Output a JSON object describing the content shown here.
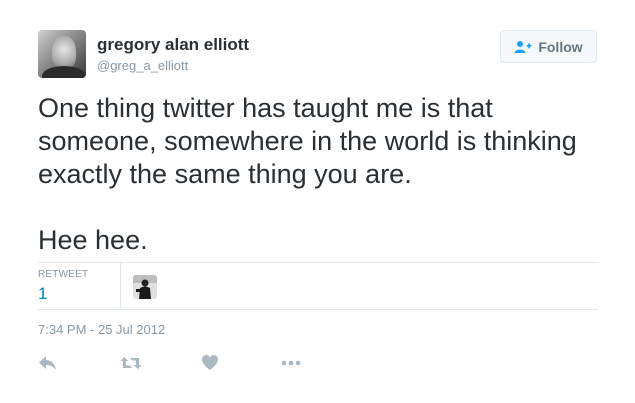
{
  "tweet": {
    "author": {
      "fullname": "gregory alan elliott",
      "username": "@greg_a_elliott"
    },
    "follow_label": "Follow",
    "text": "One thing twitter has taught me is that\nsomeone, somewhere in the world is thinking\nexactly the same thing you are.\n\nHee hee.",
    "stats": {
      "retweet_label": "RETWEET",
      "retweet_count": "1"
    },
    "timestamp": "7:34 PM - 25 Jul 2012",
    "actions": [
      "reply-icon",
      "retweet-icon",
      "heart-icon",
      "more-icon"
    ]
  },
  "colors": {
    "text": "#292f33",
    "muted": "#8899a6",
    "link": "#0084b4",
    "icon": "#aab8c2",
    "border": "#e1e8ed"
  }
}
